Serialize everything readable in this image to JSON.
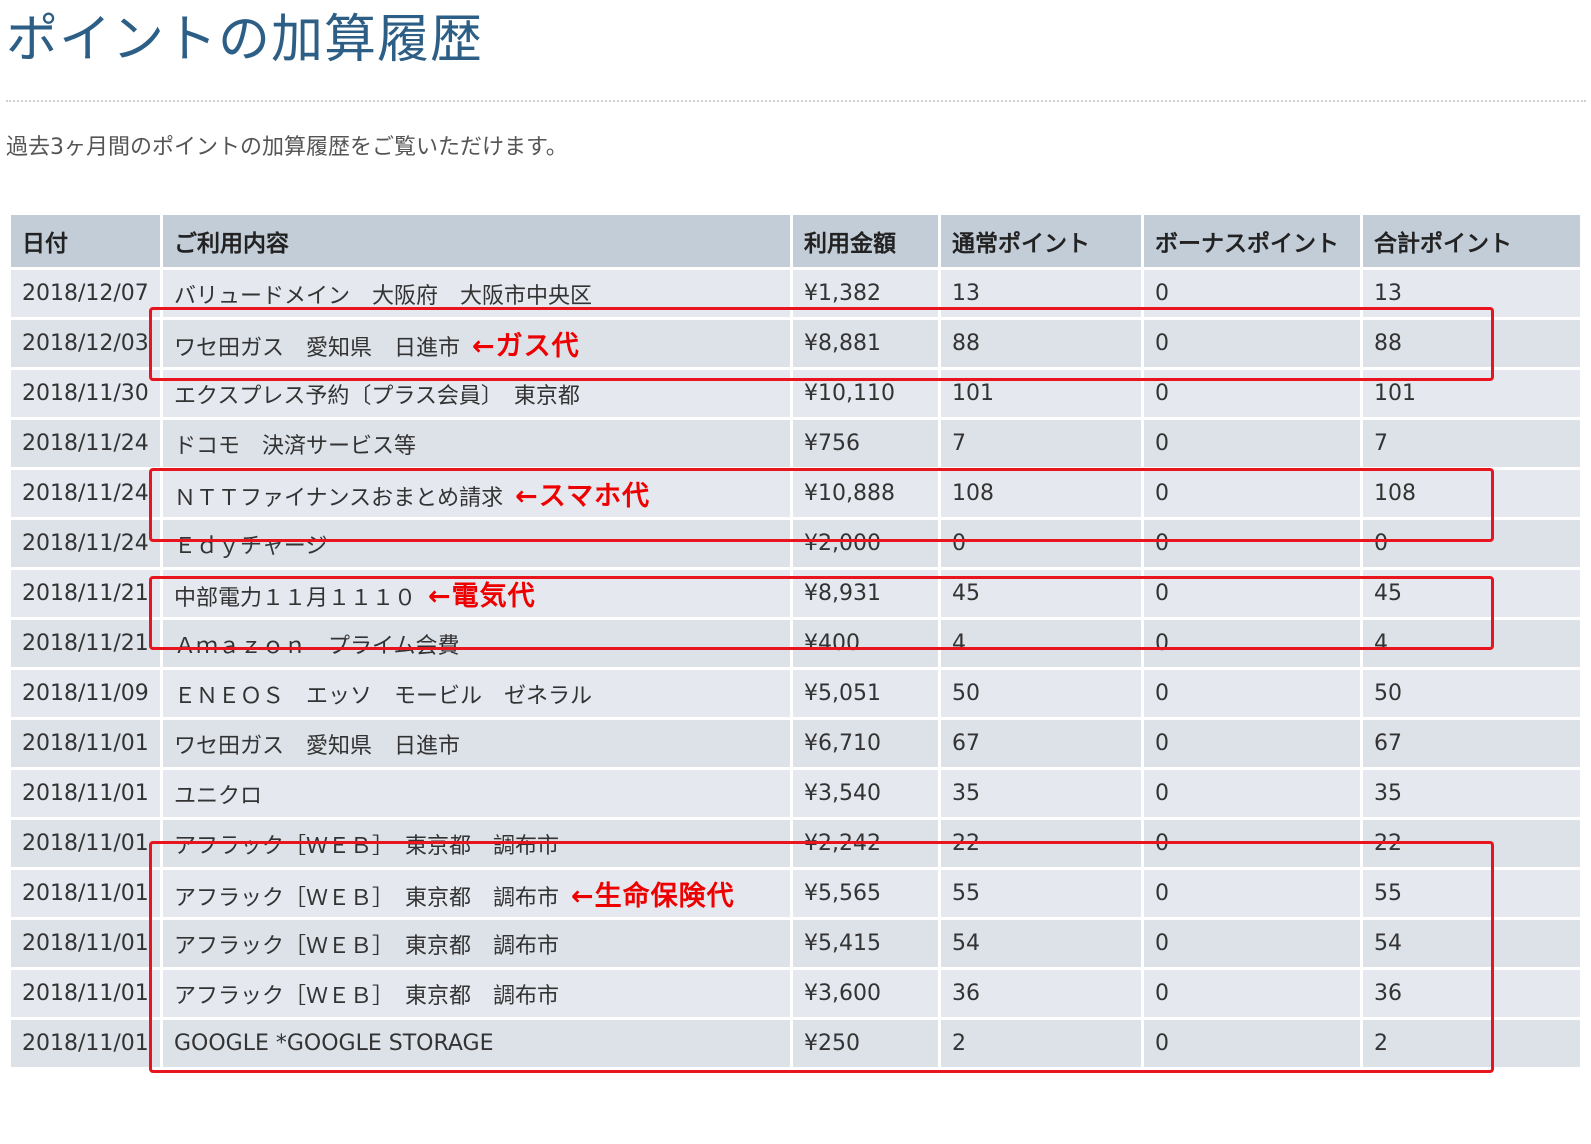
{
  "page": {
    "title": "ポイントの加算履歴",
    "description": "過去3ヶ月間のポイントの加算履歴をご覧いただけます。"
  },
  "table": {
    "headers": {
      "date": "日付",
      "description": "ご利用内容",
      "amount": "利用金額",
      "normal_points": "通常ポイント",
      "bonus_points": "ボーナスポイント",
      "total_points": "合計ポイント"
    },
    "rows": [
      {
        "date": "2018/12/07",
        "description": "バリュードメイン　大阪府　大阪市中央区",
        "note": "",
        "amount": "¥1,382",
        "normal": "13",
        "bonus": "0",
        "total": "13"
      },
      {
        "date": "2018/12/03",
        "description": "ワセ田ガス　愛知県　日進市",
        "note": "←ガス代",
        "amount": "¥8,881",
        "normal": "88",
        "bonus": "0",
        "total": "88"
      },
      {
        "date": "2018/11/30",
        "description": "エクスプレス予約〔プラス会員〕　東京都",
        "note": "",
        "amount": "¥10,110",
        "normal": "101",
        "bonus": "0",
        "total": "101"
      },
      {
        "date": "2018/11/24",
        "description": "ドコモ　決済サービス等",
        "note": "",
        "amount": "¥756",
        "normal": "7",
        "bonus": "0",
        "total": "7"
      },
      {
        "date": "2018/11/24",
        "description": "ＮＴＴファイナンスおまとめ請求",
        "note": "←スマホ代",
        "amount": "¥10,888",
        "normal": "108",
        "bonus": "0",
        "total": "108"
      },
      {
        "date": "2018/11/24",
        "description": "Ｅｄｙチャージ",
        "note": "",
        "amount": "¥2,000",
        "normal": "0",
        "bonus": "0",
        "total": "0"
      },
      {
        "date": "2018/11/21",
        "description": "中部電力１１月１１１０",
        "note": "←電気代",
        "amount": "¥8,931",
        "normal": "45",
        "bonus": "0",
        "total": "45"
      },
      {
        "date": "2018/11/21",
        "description": "Ａｍａｚｏｎ　プライム会費",
        "note": "",
        "amount": "¥400",
        "normal": "4",
        "bonus": "0",
        "total": "4"
      },
      {
        "date": "2018/11/09",
        "description": "ＥＮＥＯＳ　エッソ　モービル　ゼネラル",
        "note": "",
        "amount": "¥5,051",
        "normal": "50",
        "bonus": "0",
        "total": "50"
      },
      {
        "date": "2018/11/01",
        "description": "ワセ田ガス　愛知県　日進市",
        "note": "",
        "amount": "¥6,710",
        "normal": "67",
        "bonus": "0",
        "total": "67"
      },
      {
        "date": "2018/11/01",
        "description": "ユニクロ",
        "note": "",
        "amount": "¥3,540",
        "normal": "35",
        "bonus": "0",
        "total": "35"
      },
      {
        "date": "2018/11/01",
        "description": "アフラック［ＷＥＢ］　東京都　調布市",
        "note": "",
        "amount": "¥2,242",
        "normal": "22",
        "bonus": "0",
        "total": "22"
      },
      {
        "date": "2018/11/01",
        "description": "アフラック［ＷＥＢ］　東京都　調布市",
        "note": "←生命保険代",
        "amount": "¥5,565",
        "normal": "55",
        "bonus": "0",
        "total": "55"
      },
      {
        "date": "2018/11/01",
        "description": "アフラック［ＷＥＢ］　東京都　調布市",
        "note": "",
        "amount": "¥5,415",
        "normal": "54",
        "bonus": "0",
        "total": "54"
      },
      {
        "date": "2018/11/01",
        "description": "アフラック［ＷＥＢ］　東京都　調布市",
        "note": "",
        "amount": "¥3,600",
        "normal": "36",
        "bonus": "0",
        "total": "36"
      },
      {
        "date": "2018/11/01",
        "description": "GOOGLE *GOOGLE STORAGE",
        "note": "",
        "amount": "¥250",
        "normal": "2",
        "bonus": "0",
        "total": "2"
      }
    ]
  },
  "colors": {
    "title": "#2d5f86",
    "header_bg": "#c3cdd8",
    "row_bg": "#e5e9ef",
    "annotation": "#ee0000"
  }
}
